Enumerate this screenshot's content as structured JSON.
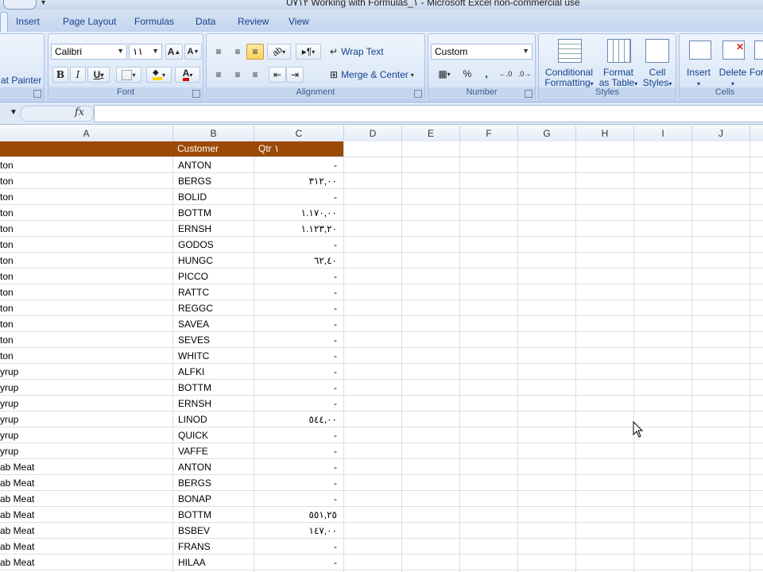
{
  "title": "U٧١٢ Working with Formulas_١ - Microsoft Excel non-commercial use",
  "tabs": [
    "Insert",
    "Page Layout",
    "Formulas",
    "Data",
    "Review",
    "View"
  ],
  "clipboard": {
    "format_painter": "at Painter"
  },
  "font": {
    "name": "Calibri",
    "size": "١١",
    "label": "Font"
  },
  "alignment": {
    "wrap_text": "Wrap Text",
    "merge_center": "Merge & Center",
    "label": "Alignment"
  },
  "number": {
    "format": "Custom",
    "label": "Number",
    "percent": "%",
    "comma": ","
  },
  "styles": {
    "conditional": [
      "Conditional",
      "Formatting"
    ],
    "format_table": [
      "Format",
      "as Table"
    ],
    "cell_styles": [
      "Cell",
      "Styles"
    ],
    "label": "Styles"
  },
  "cells": {
    "insert": "Insert",
    "delete": "Delete",
    "format": "For",
    "label": "Cells"
  },
  "formula_bar": {
    "fx": "fx",
    "value": ""
  },
  "columns": [
    "A",
    "B",
    "C",
    "D",
    "E",
    "F",
    "G",
    "H",
    "I",
    "J"
  ],
  "table": {
    "headers": {
      "b": "Customer",
      "c": "Qtr ١"
    },
    "rows": [
      {
        "a": "ton",
        "b": "ANTON",
        "c": "-"
      },
      {
        "a": "ton",
        "b": "BERGS",
        "c": "٣١٢,٠٠"
      },
      {
        "a": "ton",
        "b": "BOLID",
        "c": "-"
      },
      {
        "a": "ton",
        "b": "BOTTM",
        "c": "١.١٧٠,٠٠"
      },
      {
        "a": "ton",
        "b": "ERNSH",
        "c": "١.١٢٣,٢٠"
      },
      {
        "a": "ton",
        "b": "GODOS",
        "c": "-"
      },
      {
        "a": "ton",
        "b": "HUNGC",
        "c": "٦٢,٤٠"
      },
      {
        "a": "ton",
        "b": "PICCO",
        "c": "-"
      },
      {
        "a": "ton",
        "b": "RATTC",
        "c": "-"
      },
      {
        "a": "ton",
        "b": "REGGC",
        "c": "-"
      },
      {
        "a": "ton",
        "b": "SAVEA",
        "c": "-"
      },
      {
        "a": "ton",
        "b": "SEVES",
        "c": "-"
      },
      {
        "a": "ton",
        "b": "WHITC",
        "c": "-"
      },
      {
        "a": "yrup",
        "b": "ALFKI",
        "c": "-"
      },
      {
        "a": "yrup",
        "b": "BOTTM",
        "c": "-"
      },
      {
        "a": "yrup",
        "b": "ERNSH",
        "c": "-"
      },
      {
        "a": "yrup",
        "b": "LINOD",
        "c": "٥٤٤,٠٠"
      },
      {
        "a": "yrup",
        "b": "QUICK",
        "c": "-"
      },
      {
        "a": "yrup",
        "b": "VAFFE",
        "c": "-"
      },
      {
        "a": "ab Meat",
        "b": "ANTON",
        "c": "-"
      },
      {
        "a": "ab Meat",
        "b": "BERGS",
        "c": "-"
      },
      {
        "a": "ab Meat",
        "b": "BONAP",
        "c": "-"
      },
      {
        "a": "ab Meat",
        "b": "BOTTM",
        "c": "٥٥١,٢٥"
      },
      {
        "a": "ab Meat",
        "b": "BSBEV",
        "c": "١٤٧,٠٠"
      },
      {
        "a": "ab Meat",
        "b": "FRANS",
        "c": "-"
      },
      {
        "a": "ab Meat",
        "b": "HILAA",
        "c": "-"
      }
    ]
  },
  "colors": {
    "header_band": "#9b4a05",
    "header_text": "#ffffff"
  }
}
